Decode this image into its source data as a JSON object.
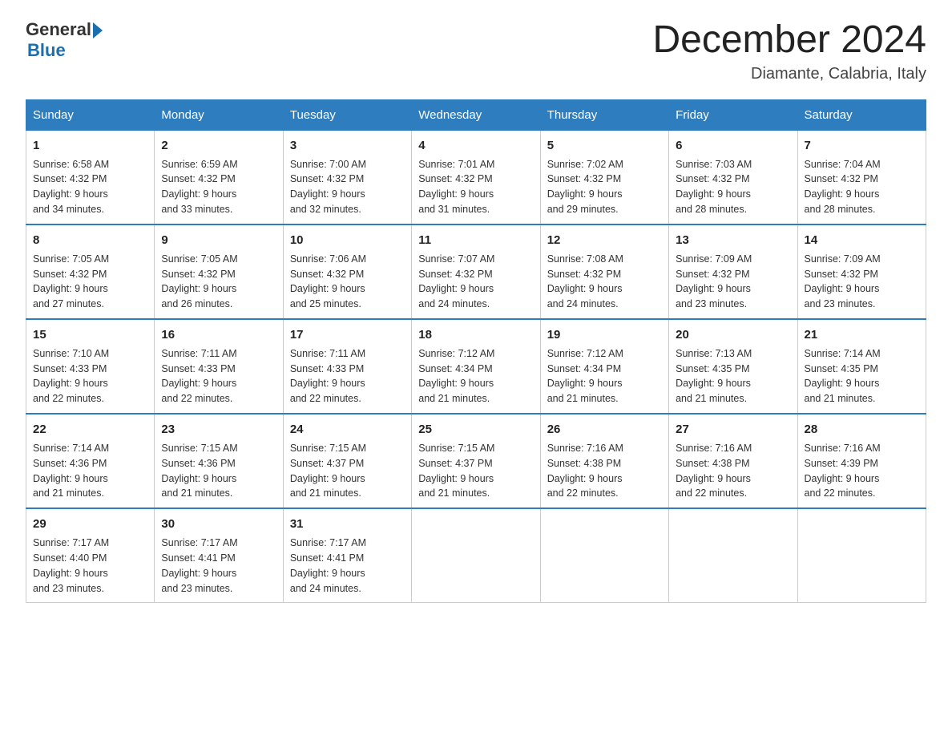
{
  "header": {
    "logo_general": "General",
    "logo_blue": "Blue",
    "page_title": "December 2024",
    "subtitle": "Diamante, Calabria, Italy"
  },
  "weekdays": [
    "Sunday",
    "Monday",
    "Tuesday",
    "Wednesday",
    "Thursday",
    "Friday",
    "Saturday"
  ],
  "weeks": [
    [
      {
        "day": "1",
        "sunrise": "6:58 AM",
        "sunset": "4:32 PM",
        "daylight": "9 hours and 34 minutes."
      },
      {
        "day": "2",
        "sunrise": "6:59 AM",
        "sunset": "4:32 PM",
        "daylight": "9 hours and 33 minutes."
      },
      {
        "day": "3",
        "sunrise": "7:00 AM",
        "sunset": "4:32 PM",
        "daylight": "9 hours and 32 minutes."
      },
      {
        "day": "4",
        "sunrise": "7:01 AM",
        "sunset": "4:32 PM",
        "daylight": "9 hours and 31 minutes."
      },
      {
        "day": "5",
        "sunrise": "7:02 AM",
        "sunset": "4:32 PM",
        "daylight": "9 hours and 29 minutes."
      },
      {
        "day": "6",
        "sunrise": "7:03 AM",
        "sunset": "4:32 PM",
        "daylight": "9 hours and 28 minutes."
      },
      {
        "day": "7",
        "sunrise": "7:04 AM",
        "sunset": "4:32 PM",
        "daylight": "9 hours and 28 minutes."
      }
    ],
    [
      {
        "day": "8",
        "sunrise": "7:05 AM",
        "sunset": "4:32 PM",
        "daylight": "9 hours and 27 minutes."
      },
      {
        "day": "9",
        "sunrise": "7:05 AM",
        "sunset": "4:32 PM",
        "daylight": "9 hours and 26 minutes."
      },
      {
        "day": "10",
        "sunrise": "7:06 AM",
        "sunset": "4:32 PM",
        "daylight": "9 hours and 25 minutes."
      },
      {
        "day": "11",
        "sunrise": "7:07 AM",
        "sunset": "4:32 PM",
        "daylight": "9 hours and 24 minutes."
      },
      {
        "day": "12",
        "sunrise": "7:08 AM",
        "sunset": "4:32 PM",
        "daylight": "9 hours and 24 minutes."
      },
      {
        "day": "13",
        "sunrise": "7:09 AM",
        "sunset": "4:32 PM",
        "daylight": "9 hours and 23 minutes."
      },
      {
        "day": "14",
        "sunrise": "7:09 AM",
        "sunset": "4:32 PM",
        "daylight": "9 hours and 23 minutes."
      }
    ],
    [
      {
        "day": "15",
        "sunrise": "7:10 AM",
        "sunset": "4:33 PM",
        "daylight": "9 hours and 22 minutes."
      },
      {
        "day": "16",
        "sunrise": "7:11 AM",
        "sunset": "4:33 PM",
        "daylight": "9 hours and 22 minutes."
      },
      {
        "day": "17",
        "sunrise": "7:11 AM",
        "sunset": "4:33 PM",
        "daylight": "9 hours and 22 minutes."
      },
      {
        "day": "18",
        "sunrise": "7:12 AM",
        "sunset": "4:34 PM",
        "daylight": "9 hours and 21 minutes."
      },
      {
        "day": "19",
        "sunrise": "7:12 AM",
        "sunset": "4:34 PM",
        "daylight": "9 hours and 21 minutes."
      },
      {
        "day": "20",
        "sunrise": "7:13 AM",
        "sunset": "4:35 PM",
        "daylight": "9 hours and 21 minutes."
      },
      {
        "day": "21",
        "sunrise": "7:14 AM",
        "sunset": "4:35 PM",
        "daylight": "9 hours and 21 minutes."
      }
    ],
    [
      {
        "day": "22",
        "sunrise": "7:14 AM",
        "sunset": "4:36 PM",
        "daylight": "9 hours and 21 minutes."
      },
      {
        "day": "23",
        "sunrise": "7:15 AM",
        "sunset": "4:36 PM",
        "daylight": "9 hours and 21 minutes."
      },
      {
        "day": "24",
        "sunrise": "7:15 AM",
        "sunset": "4:37 PM",
        "daylight": "9 hours and 21 minutes."
      },
      {
        "day": "25",
        "sunrise": "7:15 AM",
        "sunset": "4:37 PM",
        "daylight": "9 hours and 21 minutes."
      },
      {
        "day": "26",
        "sunrise": "7:16 AM",
        "sunset": "4:38 PM",
        "daylight": "9 hours and 22 minutes."
      },
      {
        "day": "27",
        "sunrise": "7:16 AM",
        "sunset": "4:38 PM",
        "daylight": "9 hours and 22 minutes."
      },
      {
        "day": "28",
        "sunrise": "7:16 AM",
        "sunset": "4:39 PM",
        "daylight": "9 hours and 22 minutes."
      }
    ],
    [
      {
        "day": "29",
        "sunrise": "7:17 AM",
        "sunset": "4:40 PM",
        "daylight": "9 hours and 23 minutes."
      },
      {
        "day": "30",
        "sunrise": "7:17 AM",
        "sunset": "4:41 PM",
        "daylight": "9 hours and 23 minutes."
      },
      {
        "day": "31",
        "sunrise": "7:17 AM",
        "sunset": "4:41 PM",
        "daylight": "9 hours and 24 minutes."
      },
      null,
      null,
      null,
      null
    ]
  ],
  "labels": {
    "sunrise": "Sunrise:",
    "sunset": "Sunset:",
    "daylight": "Daylight:"
  }
}
